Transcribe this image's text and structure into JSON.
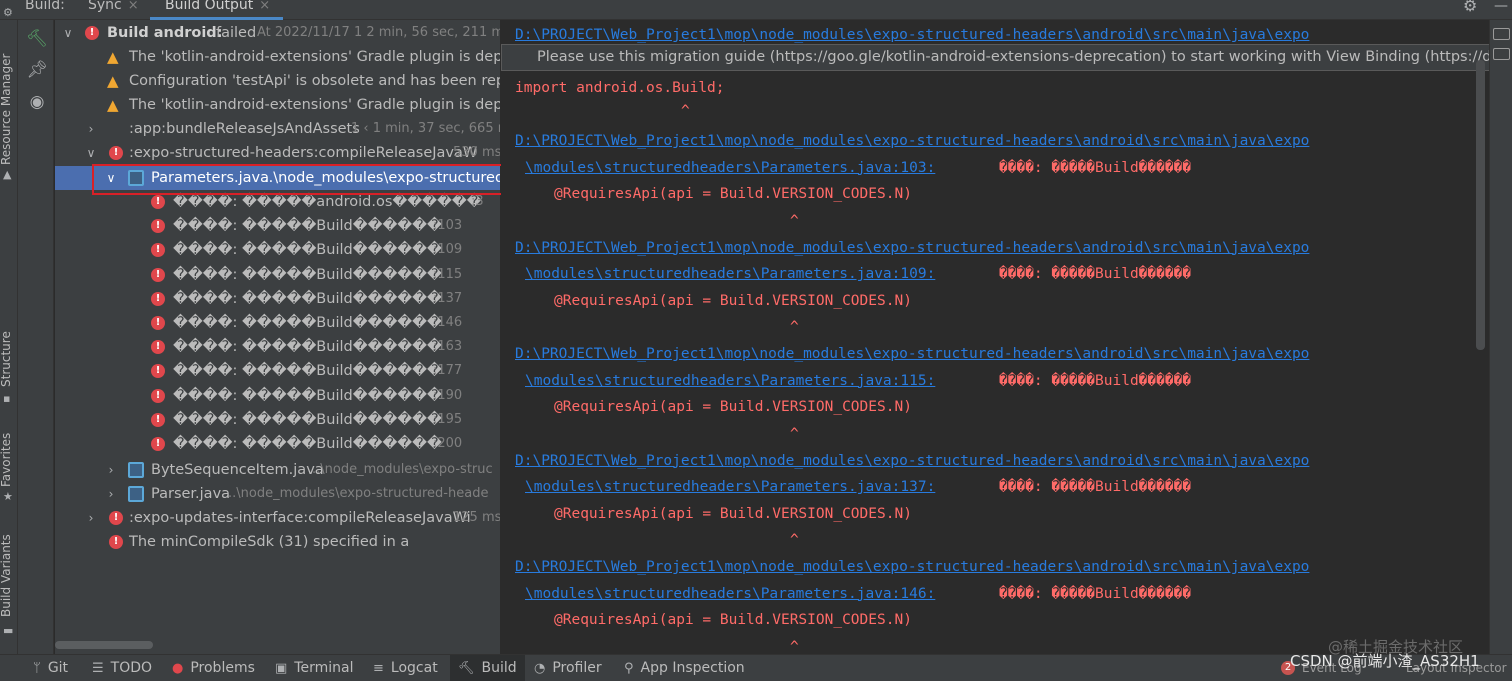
{
  "top_tabs": {
    "build_label": "Build:",
    "sync_label": "Sync",
    "output_label": "Build Output",
    "close_glyph": "×"
  },
  "left_strip": {
    "resource_manager": "Resource Manager",
    "structure": "Structure",
    "favorites": "Favorites",
    "build_variants": "Build Variants"
  },
  "tree": {
    "root": {
      "label": "Build android:",
      "status": "failed",
      "meta": "At 2022/11/17 1 2 min, 56 sec, 211 ms"
    },
    "warnings": [
      "The 'kotlin-android-extensions' Gradle plugin is deprecated.",
      "Configuration 'testApi' is obsolete and has been replac",
      "The 'kotlin-android-extensions' Gradle plugin is deprec"
    ],
    "bundle_task": {
      "label": ":app:bundleReleaseJsAndAssets",
      "meta": "1 ‹ 1 min, 37 sec, 665 ms"
    },
    "compile_task": {
      "label": ":expo-structured-headers:compileReleaseJavaW",
      "meta": "530 ms"
    },
    "selected_file": {
      "name": "Parameters.java",
      "path": "..\\node_modules\\expo-structured-h"
    },
    "file_errors": [
      {
        "msg": "����: �����android.os������",
        "line": ":3"
      },
      {
        "msg": "����: �����Build������",
        "line": ":103"
      },
      {
        "msg": "����: �����Build������",
        "line": ":109"
      },
      {
        "msg": "����: �����Build������",
        "line": ":115"
      },
      {
        "msg": "����: �����Build������",
        "line": ":137"
      },
      {
        "msg": "����: �����Build������",
        "line": ":146"
      },
      {
        "msg": "����: �����Build������",
        "line": ":163"
      },
      {
        "msg": "����: �����Build������",
        "line": ":177"
      },
      {
        "msg": "����: �����Build������",
        "line": ":190"
      },
      {
        "msg": "����: �����Build������",
        "line": ":195"
      },
      {
        "msg": "����: �����Build������",
        "line": ":200"
      }
    ],
    "other_files": [
      {
        "name": "ByteSequenceItem.java",
        "path": "..\\node_modules\\expo-struc"
      },
      {
        "name": "Parser.java",
        "path": "..\\node_modules\\expo-structured-heade"
      }
    ],
    "updates_task": {
      "label": ":expo-updates-interface:compileReleaseJavaWi",
      "meta": "125 ms"
    },
    "min_sdk_error": "The minCompileSdk (31) specified in a"
  },
  "output": {
    "tooltip": "Please use this migration guide (https://goo.gle/kotlin-android-extensions-deprecation) to start working with View Binding (https://developer.",
    "path_prefix": "D:\\PROJECT\\Web_Project1\\mop\\node_modules\\expo-structured-headers\\android\\src\\main\\java\\expo",
    "import_line": "import android.os.Build;",
    "caret": "^",
    "blocks": [
      {
        "file": "\\modules\\structuredheaders\\Parameters.java:103:",
        "msg": "����: �����Build������",
        "code": "@RequiresApi(api = Build.VERSION_CODES.N)"
      },
      {
        "file": "\\modules\\structuredheaders\\Parameters.java:109:",
        "msg": "����: �����Build������",
        "code": "@RequiresApi(api = Build.VERSION_CODES.N)"
      },
      {
        "file": "\\modules\\structuredheaders\\Parameters.java:115:",
        "msg": "����: �����Build������",
        "code": "@RequiresApi(api = Build.VERSION_CODES.N)"
      },
      {
        "file": "\\modules\\structuredheaders\\Parameters.java:137:",
        "msg": "����: �����Build������",
        "code": "@RequiresApi(api = Build.VERSION_CODES.N)"
      },
      {
        "file": "\\modules\\structuredheaders\\Parameters.java:146:",
        "msg": "����: �����Build������",
        "code": "@RequiresApi(api = Build.VERSION_CODES.N)"
      }
    ]
  },
  "bottom_tabs": [
    {
      "label": "Git",
      "icon": "git-branch-icon"
    },
    {
      "label": "TODO",
      "icon": "list-icon"
    },
    {
      "label": "Problems",
      "icon": "error-icon"
    },
    {
      "label": "Terminal",
      "icon": "terminal-icon"
    },
    {
      "label": "Logcat",
      "icon": "logcat-icon"
    },
    {
      "label": "Build",
      "icon": "hammer-icon"
    },
    {
      "label": "Profiler",
      "icon": "gauge-icon"
    },
    {
      "label": "App Inspection",
      "icon": "inspection-icon"
    }
  ],
  "status_right": {
    "event_count": "2",
    "event_log": "Event Log",
    "layout_inspector": "Layout Inspector",
    "watermark_cn": "@稀土掘金技术社区",
    "watermark_csdn": "CSDN @前端小渣_AS32H1"
  },
  "colors": {
    "bg_dark": "#2b2b2b",
    "panel": "#3c3f41",
    "selection": "#4b6eaf",
    "error_red": "#ff6b68",
    "link_blue": "#287bde",
    "warn_orange": "#f0a732",
    "annotation_red": "#d92027"
  }
}
